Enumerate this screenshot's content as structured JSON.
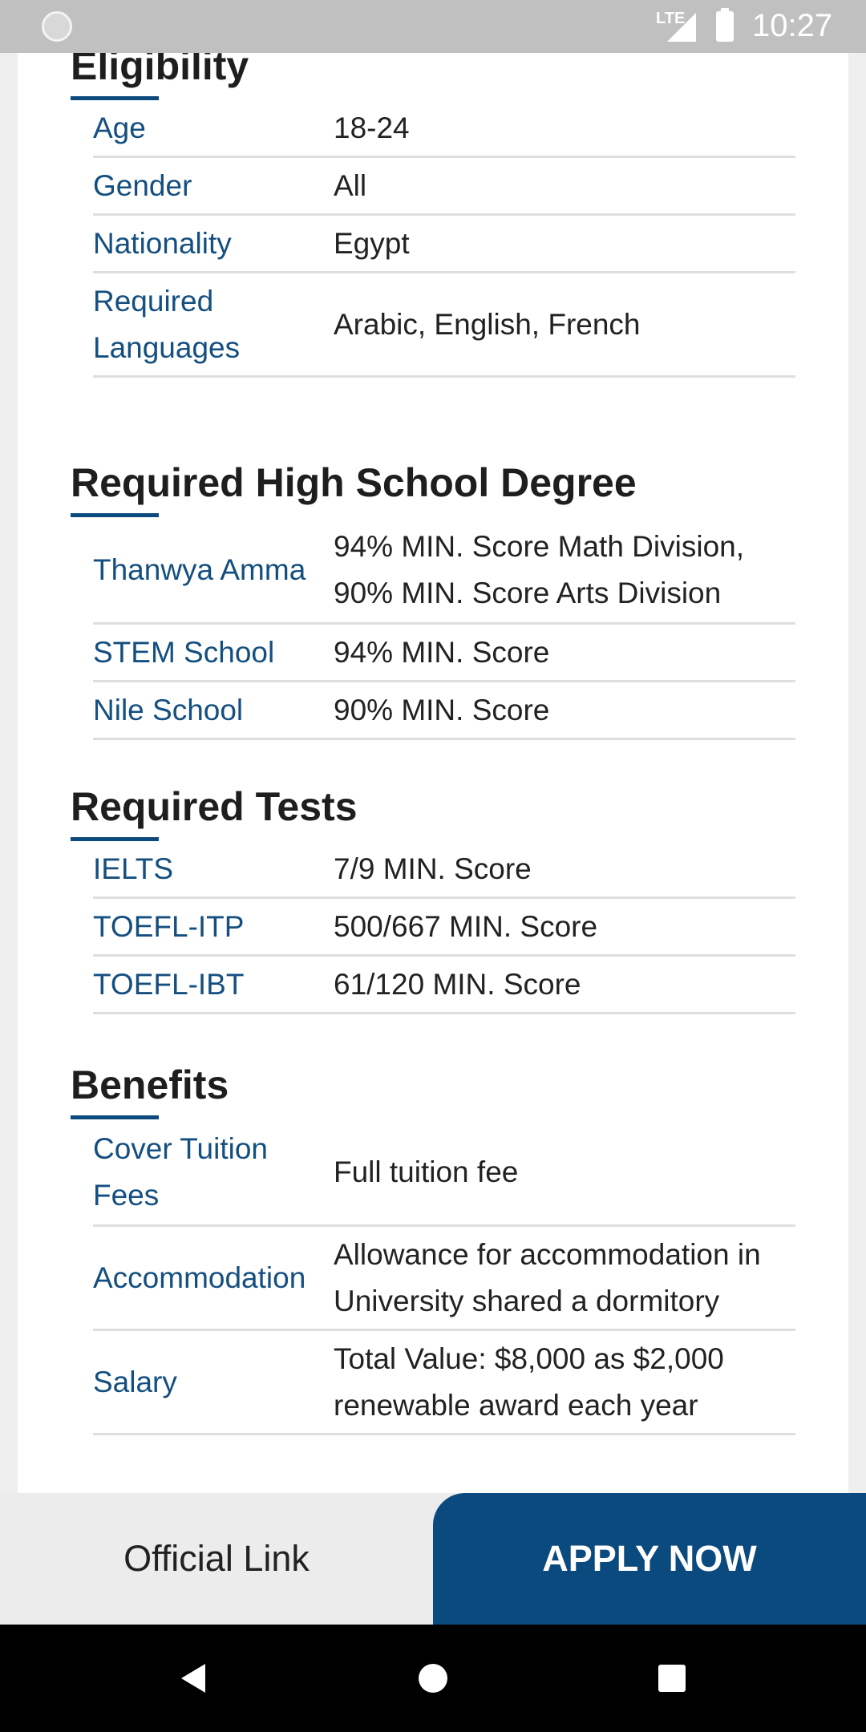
{
  "status_bar": {
    "network": "LTE",
    "time": "10:27"
  },
  "eligibility": {
    "title": "Eligibility",
    "rows": [
      {
        "label": "Age",
        "value": "18-24"
      },
      {
        "label": "Gender",
        "value": "All"
      },
      {
        "label": "Nationality",
        "value": "Egypt"
      },
      {
        "label": "Required Languages",
        "value": "Arabic, English, French"
      }
    ]
  },
  "high_school": {
    "title": "Required High School Degree",
    "rows": [
      {
        "label": "Thanwya Amma",
        "value": "94% MIN. Score Math Division, 90% MIN. Score Arts Division"
      },
      {
        "label": "STEM School",
        "value": "94% MIN. Score"
      },
      {
        "label": "Nile School",
        "value": "90% MIN. Score"
      }
    ]
  },
  "tests": {
    "title": "Required Tests",
    "rows": [
      {
        "label": "IELTS",
        "value": "7/9 MIN. Score"
      },
      {
        "label": "TOEFL-ITP",
        "value": "500/667 MIN. Score"
      },
      {
        "label": "TOEFL-IBT",
        "value": "61/120 MIN. Score"
      }
    ]
  },
  "benefits": {
    "title": "Benefits",
    "rows": [
      {
        "label": "Cover Tuition Fees",
        "value": "Full tuition fee"
      },
      {
        "label": "Accommodation",
        "value": "Allowance for accommodation in University shared a dormitory"
      },
      {
        "label": "Salary",
        "value": "Total Value: $8,000 as $2,000 renewable award each year"
      }
    ]
  },
  "actions": {
    "official_link": "Official Link",
    "apply_now": "APPLY NOW"
  },
  "colors": {
    "accent": "#0b4a7e",
    "label": "#144f80"
  },
  "nav_bar": {
    "icons": [
      "back-icon",
      "home-icon",
      "recents-icon"
    ]
  }
}
